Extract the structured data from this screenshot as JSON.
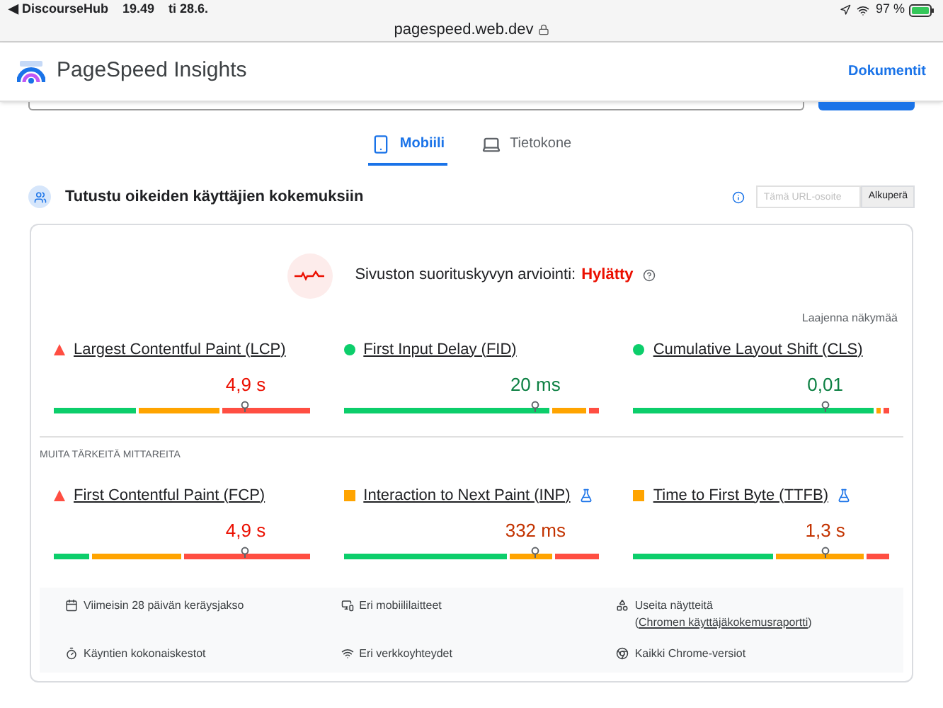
{
  "status_bar": {
    "back_app": "◀ DiscourseHub",
    "time": "19.49",
    "date": "ti 28.6.",
    "battery": "97 %"
  },
  "address_bar": {
    "url": "pagespeed.web.dev"
  },
  "header": {
    "title": "PageSpeed Insights",
    "link": "Dokumentit"
  },
  "tabs": [
    {
      "label": "Mobiili",
      "kind": "phone",
      "selected": true
    },
    {
      "label": "Tietokone",
      "kind": "laptop",
      "selected": false
    }
  ],
  "section": {
    "title": "Tutustu oikeiden käyttäjien kokemuksiin",
    "url_placeholder": "Tämä URL-osoite",
    "origin_button": "Alkuperä"
  },
  "assessment": {
    "label": "Sivuston suorituskyvyn arviointi:",
    "result": "Hylätty",
    "expand": "Laajenna näkymää"
  },
  "core_metrics": [
    {
      "name": "Largest Contentful Paint (LCP)",
      "value": "4,9 s",
      "kind": "poor",
      "experimental": false,
      "segments": [
        {
          "kind": "good"
        },
        {
          "kind": "ni"
        },
        {
          "kind": "poor"
        }
      ]
    },
    {
      "name": "First Input Delay (FID)",
      "value": "20 ms",
      "kind": "good",
      "experimental": false,
      "segments": [
        {
          "kind": "good"
        },
        {
          "kind": "ni"
        },
        {
          "kind": "poor"
        }
      ]
    },
    {
      "name": "Cumulative Layout Shift (CLS)",
      "value": "0,01",
      "kind": "good",
      "experimental": false,
      "segments": [
        {
          "kind": "good"
        },
        {
          "kind": "ni"
        },
        {
          "kind": "poor"
        }
      ]
    }
  ],
  "other_heading": "MUITA TÄRKEITÄ MITTAREITA",
  "other_metrics": [
    {
      "name": "First Contentful Paint (FCP)",
      "value": "4,9 s",
      "kind": "poor",
      "experimental": false,
      "segments": [
        {
          "kind": "good"
        },
        {
          "kind": "ni"
        },
        {
          "kind": "poor"
        }
      ]
    },
    {
      "name": "Interaction to Next Paint (INP)",
      "value": "332 ms",
      "kind": "ni",
      "experimental": true,
      "segments": [
        {
          "kind": "good"
        },
        {
          "kind": "ni"
        },
        {
          "kind": "poor"
        }
      ]
    },
    {
      "name": "Time to First Byte (TTFB)",
      "value": "1,3 s",
      "kind": "ni",
      "experimental": true,
      "segments": [
        {
          "kind": "good"
        },
        {
          "kind": "ni"
        },
        {
          "kind": "poor"
        }
      ]
    }
  ],
  "info": [
    {
      "kind": "calendar",
      "text": "Viimeisin 28 päivän keräysjakso"
    },
    {
      "kind": "devices",
      "text": "Eri mobiililaitteet"
    },
    {
      "kind": "samples",
      "text": "Useita näytteitä (",
      "link": "Chromen käyttäjäkokemusraportti",
      "after": ")"
    },
    {
      "kind": "timer",
      "text": "Käyntien kokonaiskestot"
    },
    {
      "kind": "wifi",
      "text": "Eri verkkoyhteydet"
    },
    {
      "kind": "chrome",
      "text": "Kaikki Chrome-versiot"
    }
  ]
}
